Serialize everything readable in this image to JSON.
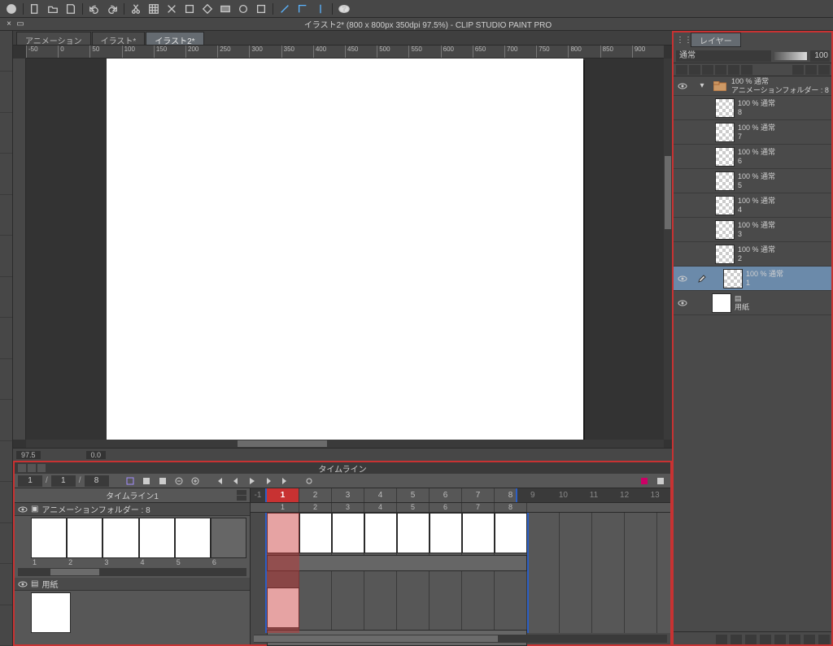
{
  "app": {
    "title": "イラスト2* (800 x 800px 350dpi 97.5%)  - CLIP STUDIO PAINT PRO"
  },
  "tabs": [
    {
      "label": "アニメーション",
      "active": false
    },
    {
      "label": "イラスト*",
      "active": false
    },
    {
      "label": "イラスト2*",
      "active": true
    }
  ],
  "ruler_h": [
    "-50",
    "0",
    "50",
    "100",
    "150",
    "200",
    "250",
    "300",
    "350",
    "400",
    "450",
    "500",
    "550",
    "600",
    "650",
    "700",
    "750",
    "800",
    "850",
    "900"
  ],
  "status": {
    "zoom": "97.5",
    "rotation": "0.0"
  },
  "timeline": {
    "title": "タイムライン",
    "name": "タイムライン1",
    "cur_frame": "1",
    "total_frames_a": "1",
    "total_frames_b": "8",
    "frames": [
      "-1",
      "1",
      "2",
      "3",
      "4",
      "5",
      "6",
      "7",
      "8"
    ],
    "end_frames": [
      "9",
      "10",
      "11",
      "12",
      "13"
    ],
    "sec_frames": [
      "1",
      "2",
      "3",
      "4",
      "5",
      "6",
      "7",
      "8"
    ],
    "track1": {
      "name": "アニメーションフォルダー : 8",
      "cels": [
        "1",
        "2",
        "3",
        "4",
        "5",
        "6"
      ]
    },
    "track2": {
      "name": "用紙"
    }
  },
  "layer_panel": {
    "tab": "レイヤー",
    "blend_mode": "通常",
    "opacity": "100",
    "folder": {
      "opacity_mode": "100 % 通常",
      "name": "アニメーションフォルダー : 8"
    },
    "layers": [
      {
        "opacity_mode": "100 % 通常",
        "name": "8"
      },
      {
        "opacity_mode": "100 % 通常",
        "name": "7"
      },
      {
        "opacity_mode": "100 % 通常",
        "name": "6"
      },
      {
        "opacity_mode": "100 % 通常",
        "name": "5"
      },
      {
        "opacity_mode": "100 % 通常",
        "name": "4"
      },
      {
        "opacity_mode": "100 % 通常",
        "name": "3"
      },
      {
        "opacity_mode": "100 % 通常",
        "name": "2"
      },
      {
        "opacity_mode": "100 % 通常",
        "name": "1"
      }
    ],
    "paper": {
      "name": "用紙"
    }
  }
}
